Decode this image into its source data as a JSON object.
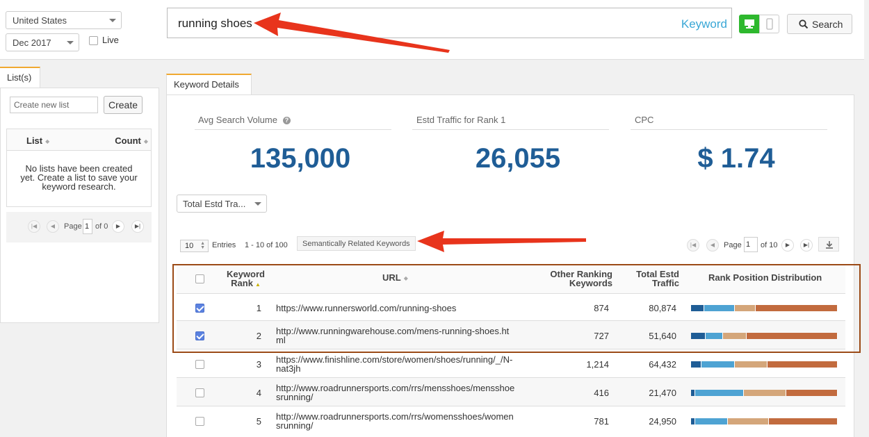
{
  "filters": {
    "country": "United States",
    "date": "Dec 2017",
    "live_label": "Live"
  },
  "search": {
    "query": "running shoes",
    "mode_label": "Keyword",
    "button_label": "Search"
  },
  "lists_panel": {
    "tab_label": "List(s)",
    "new_list_placeholder": "Create new list",
    "create_button": "Create",
    "col_list": "List",
    "col_count": "Count",
    "empty_message": "No lists have been created yet. Create a list to save your keyword research.",
    "page_label": "Page",
    "page_value": "1",
    "of_label": "of 0"
  },
  "main": {
    "tab_label": "Keyword Details",
    "stats": [
      {
        "label": "Avg Search Volume",
        "value": "135,000"
      },
      {
        "label": "Estd Traffic for Rank 1",
        "value": "26,055"
      },
      {
        "label": "CPC",
        "value": "$ 1.74"
      }
    ],
    "metric_select": "Total Estd Tra...",
    "entries_value": "10",
    "entries_label": "Entries",
    "range_label": "1 - 10 of 100",
    "semantic_button": "Semantically Related Keywords",
    "page_label": "Page",
    "page_value": "1",
    "of_label": "of 10"
  },
  "table": {
    "headers": {
      "rank": "Keyword Rank",
      "url": "URL",
      "other": "Other Ranking Keywords",
      "traffic": "Total Estd Traffic",
      "dist": "Rank Position Distribution"
    },
    "rows": [
      {
        "checked": true,
        "rank": "1",
        "url": "https://www.runnersworld.com/running-shoes",
        "other": "874",
        "traffic": "80,874",
        "dist": [
          0.09,
          0.21,
          0.14,
          0.56
        ]
      },
      {
        "checked": true,
        "rank": "2",
        "url": "http://www.runningwarehouse.com/mens-running-shoes.html",
        "other": "727",
        "traffic": "51,640",
        "dist": [
          0.1,
          0.12,
          0.16,
          0.62
        ]
      },
      {
        "checked": false,
        "rank": "3",
        "url": "https://www.finishline.com/store/women/shoes/running/_/N-nat3jh",
        "other": "1,214",
        "traffic": "64,432",
        "dist": [
          0.07,
          0.23,
          0.22,
          0.48
        ]
      },
      {
        "checked": false,
        "rank": "4",
        "url": "http://www.roadrunnersports.com/rrs/mensshoes/mensshoesrunning/",
        "other": "416",
        "traffic": "21,470",
        "dist": [
          0.03,
          0.33,
          0.29,
          0.35
        ]
      },
      {
        "checked": false,
        "rank": "5",
        "url": "http://www.roadrunnersports.com/rrs/womensshoes/womensrunning/",
        "other": "781",
        "traffic": "24,950",
        "dist": [
          0.03,
          0.22,
          0.28,
          0.47
        ]
      }
    ]
  },
  "colors": {
    "dist": [
      "#1f5d96",
      "#4ea3d3",
      "#d4a67a",
      "#c26b3e"
    ],
    "accent_tab": "#f0a830",
    "highlight_border": "#9b4a16",
    "arrow": "#e8341c"
  }
}
